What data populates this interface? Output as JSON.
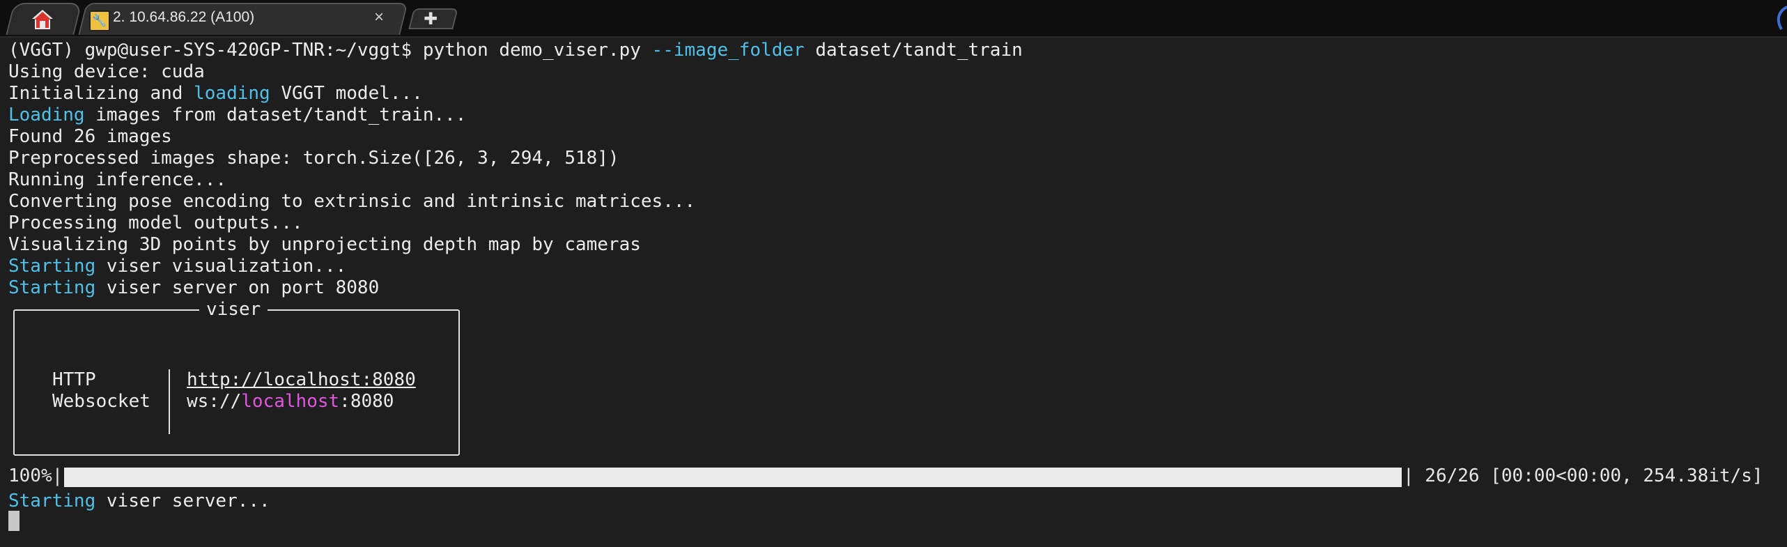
{
  "tabs": {
    "home": {
      "icon": "home-icon"
    },
    "session": {
      "icon": "wrench-icon",
      "title": "2. 10.64.86.22 (A100)",
      "close_label": "×"
    },
    "new_tab": {
      "icon": "plus-icon",
      "label": "✚"
    }
  },
  "terminal": {
    "prompt_line": {
      "prefix": "(VGGT) gwp@user-SYS-420GP-TNR:~/vggt$ python demo_viser.py ",
      "flag": "--image_folder",
      "suffix": " dataset/tandt_train"
    },
    "device_line": "Using device: cuda",
    "init_line": {
      "a": "Initializing and ",
      "b": "loading",
      "c": " VGGT model..."
    },
    "loading_line": {
      "a": "Loading",
      "b": " images from dataset/tandt_train..."
    },
    "found_line": "Found 26 images",
    "shape_line": "Preprocessed images shape: torch.Size([26, 3, 294, 518])",
    "inference_line": "Running inference...",
    "pose_line": "Converting pose encoding to extrinsic and intrinsic matrices...",
    "outputs_line": "Processing model outputs...",
    "visualizing_line": "Visualizing 3D points by unprojecting depth map by cameras",
    "start_vis_line": {
      "a": "Starting",
      "b": " viser visualization..."
    },
    "start_server_port_line": {
      "a": "Starting",
      "b": " viser server on port 8080"
    },
    "viser_box": {
      "title": "viser",
      "http_label": "HTTP",
      "http_url": "http://localhost:8080",
      "ws_label": "Websocket",
      "ws_prefix": "ws://",
      "ws_host": "localhost",
      "ws_port": ":8080"
    },
    "progress": {
      "percent_label": "100%|",
      "fraction": 1.0,
      "stats": "| 26/26 [00:00<00:00, 254.38it/s]"
    },
    "final_line": {
      "a": "Starting",
      "b": " viser server..."
    }
  },
  "colors": {
    "background": "#1e1e1e",
    "text": "#ececec",
    "cyan": "#4fc1e9",
    "magenta": "#e055e0",
    "progress_fill": "#ebebeb"
  }
}
